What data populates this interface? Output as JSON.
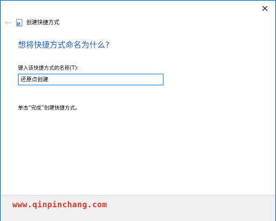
{
  "window": {
    "close_glyph": "✕",
    "title": "创建快捷方式"
  },
  "nav": {
    "back_glyph": "←"
  },
  "main": {
    "heading": "想将快捷方式命名为什么?",
    "name_label": "键入该快捷方式的名称(T):",
    "name_value": "还原点创建",
    "finish_hint": "单击“完成”创建快捷方式。"
  },
  "watermark": {
    "text": "www.qinpinchang.com",
    "color": "#e0332a"
  },
  "colors": {
    "border": "#1979ca",
    "heading": "#1a5fb4",
    "input_focus": "#3a8ee6",
    "footer": "#f0f0f0"
  },
  "icons": {
    "back": "back-arrow-icon",
    "close": "close-icon",
    "wizard": "shortcut-wizard-icon"
  }
}
